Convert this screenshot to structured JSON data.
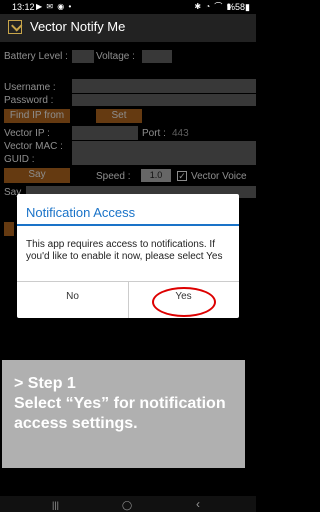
{
  "status_bar": {
    "time": "13:12",
    "left_icons": "▶ ✉ ◉ •",
    "right_icons": "✱ ◔ ⌒ ▮",
    "battery": "%58▮"
  },
  "app": {
    "title": "Vector Notify Me"
  },
  "form": {
    "battery_label": "Battery Level :",
    "voltage_label": "Voltage :",
    "username_label": "Username :",
    "password_label": "Password :",
    "find_ip_label": "Find IP from",
    "set_label": "Set",
    "vector_ip_label": "Vector IP :",
    "port_label": "Port :",
    "port_value": "443",
    "vector_mac_label": "Vector MAC :",
    "guid_label": "GUID :",
    "say_label": "Say",
    "speed_label": "Speed :",
    "speed_value": "1.0",
    "vector_voice_label": "Vector Voice",
    "say_text_label": "Say"
  },
  "dialog": {
    "title": "Notification Access",
    "message": "This app requires access to notifications. If you'd like to enable it now, please select Yes",
    "no_label": "No",
    "yes_label": "Yes"
  },
  "callout": {
    "line1": "> Step 1",
    "line2": "Select “Yes” for notification access settings."
  },
  "nav": {
    "recents": "|||",
    "home": "◯",
    "back": "‹"
  }
}
